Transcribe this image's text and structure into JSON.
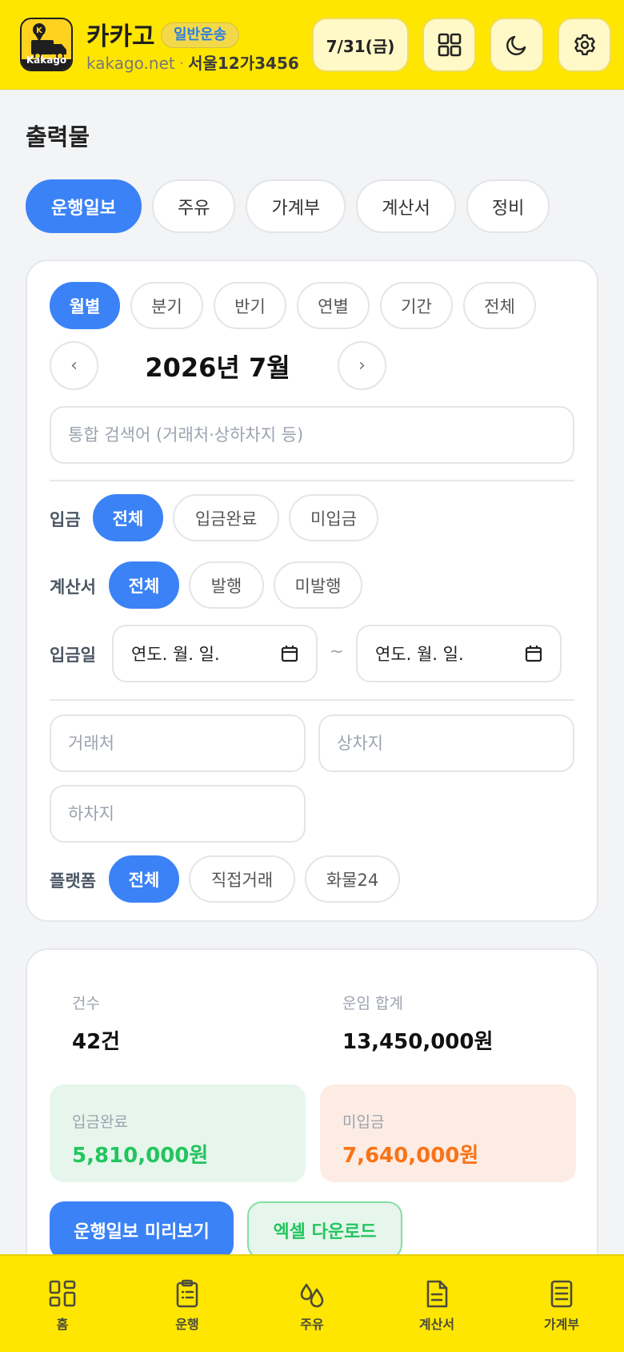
{
  "header": {
    "app_name": "카카고",
    "badge": "일반운송",
    "site": "kakago.net",
    "separator": "·",
    "plate": "서울12가3456",
    "logo_text": "Kakago",
    "date": "7/31(금)",
    "icons": [
      "grid-icon",
      "moon-icon",
      "gear-icon"
    ]
  },
  "page": {
    "title": "출력물"
  },
  "tabs": [
    {
      "label": "운행일보",
      "active": true
    },
    {
      "label": "주유",
      "active": false
    },
    {
      "label": "가계부",
      "active": false
    },
    {
      "label": "계산서",
      "active": false
    },
    {
      "label": "정비",
      "active": false
    }
  ],
  "filters": {
    "periods": [
      {
        "label": "월별",
        "active": true
      },
      {
        "label": "분기",
        "active": false
      },
      {
        "label": "반기",
        "active": false
      },
      {
        "label": "연별",
        "active": false
      },
      {
        "label": "기간",
        "active": false
      },
      {
        "label": "전체",
        "active": false
      }
    ],
    "prev": "‹",
    "next": "›",
    "current_period": "2026년 7월",
    "search_placeholder": "통합 검색어 (거래처·상하차지 등)",
    "payment": {
      "label": "입금",
      "options": [
        "전체",
        "입금완료",
        "미입금"
      ],
      "selected": "전체"
    },
    "invoice": {
      "label": "계산서",
      "options": [
        "전체",
        "발행",
        "미발행"
      ],
      "selected": "전체"
    },
    "payment_date": {
      "label": "입금일",
      "from_placeholder": "연도. 월. 일.",
      "to_placeholder": "연도. 월. 일.",
      "tilde": "~"
    },
    "client_placeholder": "거래처",
    "loading_placeholder": "상차지",
    "unloading_placeholder": "하차지",
    "platform": {
      "label": "플랫폼",
      "options": [
        "전체",
        "직접거래",
        "화물24"
      ],
      "selected": "전체"
    }
  },
  "summary": {
    "count_label": "건수",
    "count_value": "42건",
    "total_label": "운임 합계",
    "total_value": "13,450,000원",
    "paid_label": "입금완료",
    "paid_value": "5,810,000원",
    "unpaid_label": "미입금",
    "unpaid_value": "7,640,000원",
    "preview_button": "운행일보 미리보기",
    "excel_button": "엑셀 다운로드"
  },
  "bottom_nav": [
    {
      "label": "홈",
      "icon": "home-grid-icon"
    },
    {
      "label": "운행",
      "icon": "clipboard-icon"
    },
    {
      "label": "주유",
      "icon": "fuel-drop-icon"
    },
    {
      "label": "계산서",
      "icon": "document-icon"
    },
    {
      "label": "가계부",
      "icon": "ledger-icon"
    }
  ],
  "colors": {
    "brand_yellow": "#ffe600",
    "accent_blue": "#3b82f6",
    "paid_green": "#22c55e",
    "unpaid_orange": "#f97316"
  }
}
